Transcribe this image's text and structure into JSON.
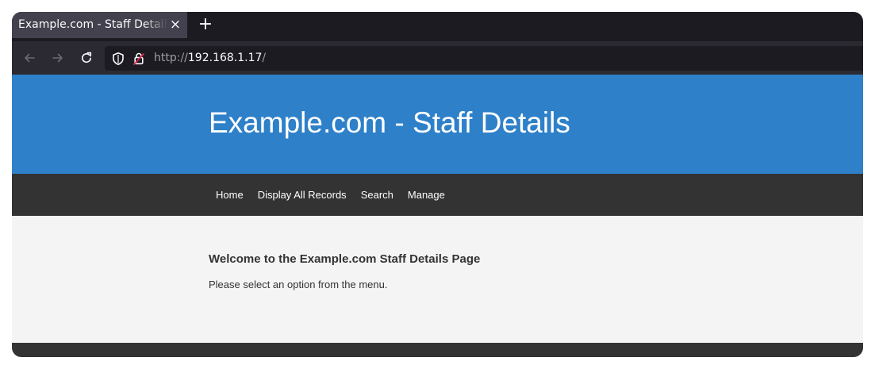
{
  "browser": {
    "tab_title": "Example.com - Staff Details",
    "tab_close": "×",
    "new_tab": "+",
    "url_scheme": "http://",
    "url_host": "192.168.1.17",
    "url_path": "/"
  },
  "site": {
    "title": "Example.com - Staff Details",
    "nav": [
      {
        "label": "Home"
      },
      {
        "label": "Display All Records"
      },
      {
        "label": "Search"
      },
      {
        "label": "Manage"
      }
    ],
    "welcome_heading": "Welcome to the Example.com Staff Details Page",
    "welcome_text": "Please select an option from the menu."
  },
  "colors": {
    "header_blue": "#2e80c9",
    "nav_dark": "#333333",
    "content_bg": "#f4f4f4",
    "chrome_dark": "#1c1b22",
    "chrome_toolbar": "#2b2a33",
    "tab_active": "#42414d"
  },
  "icons": {
    "back": "arrow-left-icon",
    "forward": "arrow-right-icon",
    "reload": "reload-icon",
    "tracking": "shield-icon",
    "insecure": "insecure-lock-icon",
    "close": "close-icon",
    "new_tab": "plus-icon"
  }
}
